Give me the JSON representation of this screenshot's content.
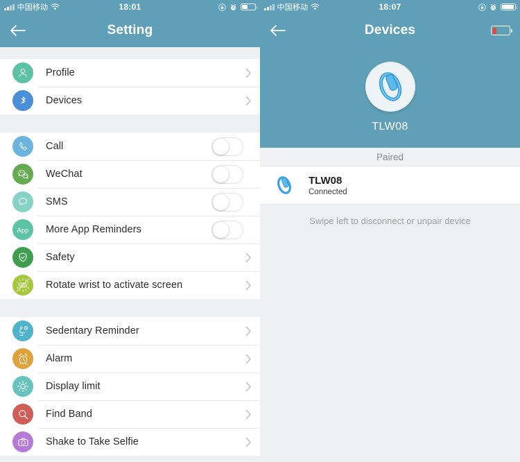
{
  "left": {
    "status_bar": {
      "carrier": "中国移动",
      "time": "18:01",
      "signal_icon": "signal-bars-icon",
      "wifi_icon": "wifi-icon",
      "rotation_lock_icon": "rotation-lock-icon",
      "alarm_icon": "alarm-clock-icon",
      "battery_icon": "battery-icon",
      "battery_level": 45
    },
    "nav": {
      "back_icon": "back-arrow-icon",
      "title": "Setting"
    },
    "groups": [
      {
        "rows": [
          {
            "label": "Profile",
            "icon": "profile-icon",
            "color": "#5bc2a4",
            "accessory": "chevron"
          },
          {
            "label": "Devices",
            "icon": "bluetooth-icon",
            "color": "#4a90d9",
            "accessory": "chevron"
          }
        ]
      },
      {
        "rows": [
          {
            "label": "Call",
            "icon": "phone-icon",
            "color": "#6bb4dd",
            "accessory": "switch",
            "on": false
          },
          {
            "label": "WeChat",
            "icon": "wechat-icon",
            "color": "#66ab52",
            "accessory": "switch",
            "on": false
          },
          {
            "label": "SMS",
            "icon": "sms-icon",
            "color": "#86d2c4",
            "accessory": "switch",
            "on": false
          },
          {
            "label": "More App Reminders",
            "icon": "app-icon",
            "color": "#5cc3a3",
            "accessory": "switch",
            "on": false
          },
          {
            "label": "Safety",
            "icon": "shield-icon",
            "color": "#3f9e4d",
            "accessory": "chevron"
          },
          {
            "label": "Rotate wrist to activate screen",
            "icon": "rotate-wrist-icon",
            "color": "#a5c73b",
            "accessory": "chevron"
          }
        ]
      },
      {
        "rows": [
          {
            "label": "Sedentary Reminder",
            "icon": "sedentary-icon",
            "color": "#4fb3cc",
            "accessory": "chevron"
          },
          {
            "label": "Alarm",
            "icon": "alarm-icon",
            "color": "#e0a33c",
            "accessory": "chevron"
          },
          {
            "label": "Display limit",
            "icon": "brightness-icon",
            "color": "#68c3bd",
            "accessory": "chevron"
          },
          {
            "label": "Find Band",
            "icon": "search-icon",
            "color": "#d05d58",
            "accessory": "chevron"
          },
          {
            "label": "Shake to Take Selfie",
            "icon": "camera-icon",
            "color": "#b57ad8",
            "accessory": "chevron"
          }
        ]
      }
    ]
  },
  "right": {
    "status_bar": {
      "carrier": "中国移动",
      "time": "18:07",
      "signal_icon": "signal-bars-icon",
      "wifi_icon": "wifi-icon",
      "rotation_lock_icon": "rotation-lock-icon",
      "alarm_icon": "alarm-clock-icon",
      "battery_icon": "battery-icon",
      "battery_level": 95
    },
    "nav": {
      "back_icon": "back-arrow-icon",
      "title": "Devices",
      "battery_icon": "device-battery-icon",
      "battery_level": 25,
      "battery_color": "#e8453c"
    },
    "hero": {
      "device_icon": "fitness-band-icon",
      "device_name": "TLW08"
    },
    "section_header": "Paired",
    "paired_device": {
      "icon": "fitness-band-icon",
      "name": "TLW08",
      "status": "Connected"
    },
    "hint": "Swipe left to disconnect or unpair device"
  },
  "theme": {
    "header_blue": "#5fa0b8",
    "page_gray": "#eff0f3",
    "row_white": "#ffffff",
    "divider": "#e6e7ea",
    "chevron_gray": "#c3c6cb"
  }
}
